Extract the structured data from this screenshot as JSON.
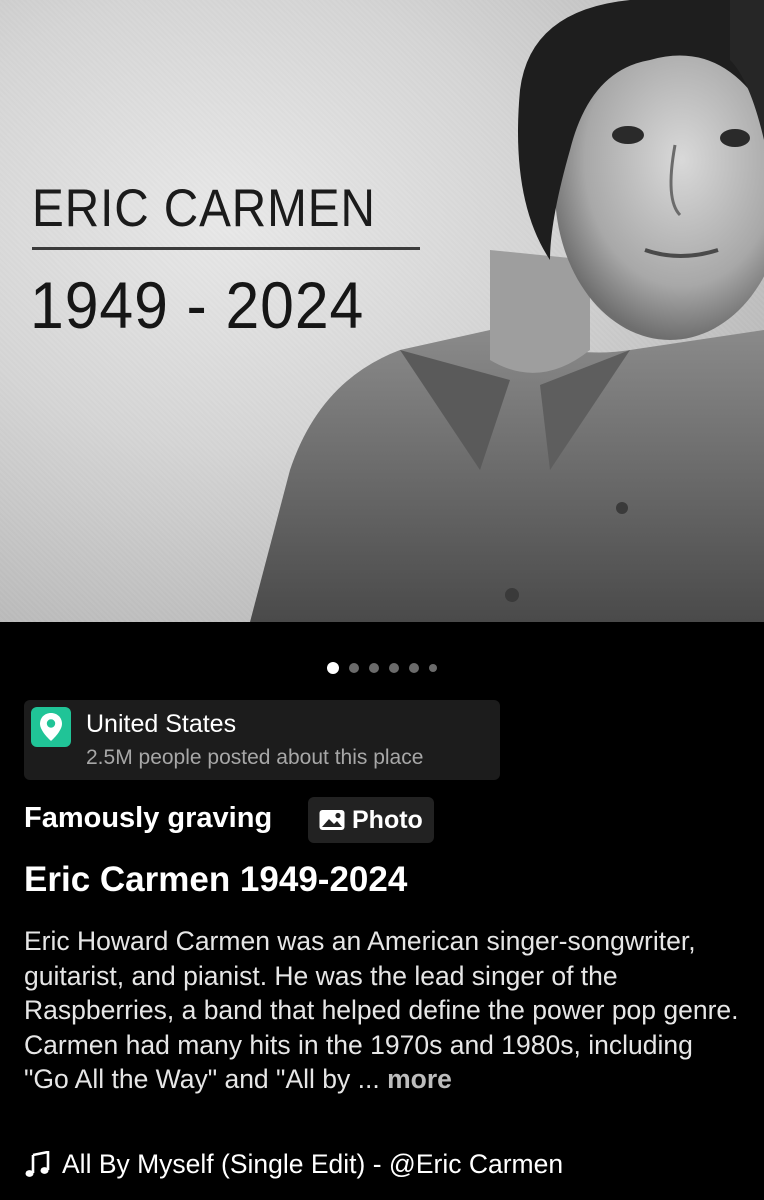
{
  "hero": {
    "title": "ERIC CARMEN",
    "years": "1949 - 2024"
  },
  "carousel": {
    "count": 6,
    "active_index": 0
  },
  "location": {
    "icon": "location-pin-icon",
    "name": "United States",
    "subtitle": "2.5M people posted about this place",
    "accent": "#20c497"
  },
  "post": {
    "topic": "Famously graving",
    "chip_icon": "photo-icon",
    "chip_label": "Photo",
    "title": "Eric Carmen 1949-2024",
    "description": "Eric Howard Carmen was an American singer-songwriter, guitarist, and pianist. He was the lead singer of the Raspberries, a band that helped define the power pop genre. Carmen had many hits in the 1970s and 1980s, including \"Go All the Way\" and \"All by ...",
    "more_label": "more"
  },
  "music": {
    "icon": "music-note-icon",
    "text": "All By Myself (Single Edit) - @Eric Carmen"
  }
}
